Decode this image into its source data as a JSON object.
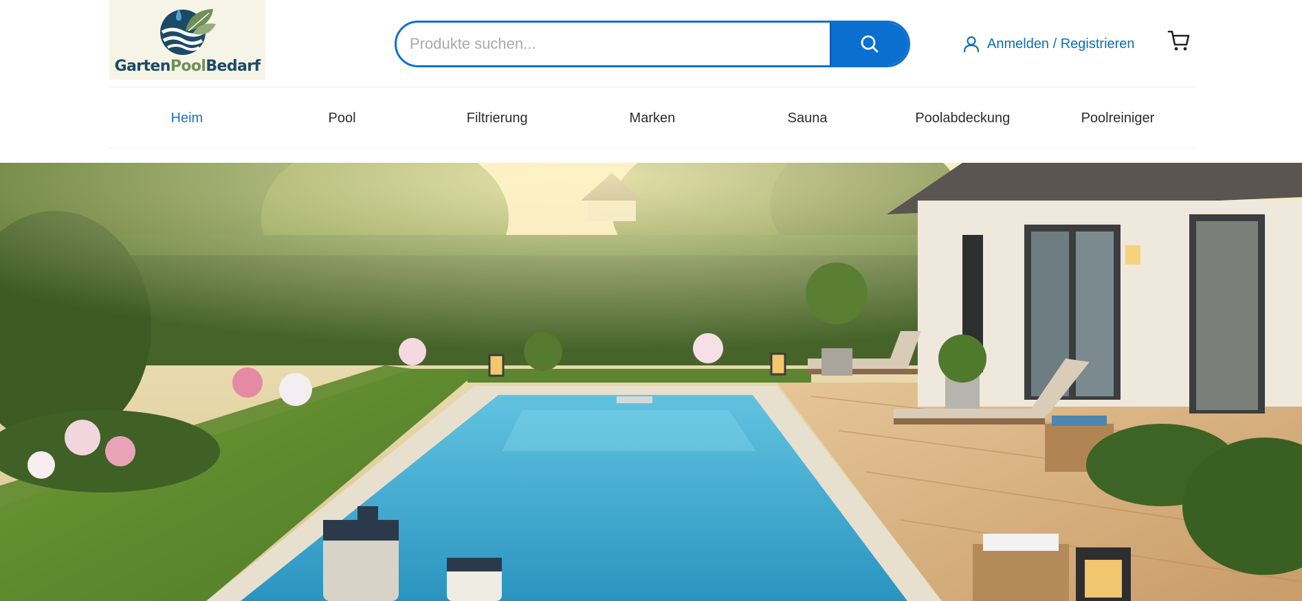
{
  "brand": {
    "logo_word_1": "Garten",
    "logo_word_2": "Pool",
    "logo_word_3": "Bedarf",
    "colors": {
      "primary": "#0b6fd0",
      "navy": "#1b4a66",
      "leaf": "#6f8f5a",
      "link": "#0b6fb5"
    }
  },
  "search": {
    "placeholder": "Produkte suchen...",
    "value": "",
    "button_icon": "search-icon"
  },
  "account": {
    "icon": "user-icon",
    "label": "Anmelden / Registrieren"
  },
  "cart": {
    "icon": "cart-icon"
  },
  "nav": {
    "items": [
      {
        "label": "Heim",
        "active": true
      },
      {
        "label": "Pool",
        "active": false
      },
      {
        "label": "Filtrierung",
        "active": false
      },
      {
        "label": "Marken",
        "active": false
      },
      {
        "label": "Sauna",
        "active": false
      },
      {
        "label": "Poolabdeckung",
        "active": false
      },
      {
        "label": "Poolreiniger",
        "active": false
      }
    ]
  },
  "hero": {
    "image": "garden-pool-hero",
    "colors": {
      "sky": "#f2e7c8",
      "hedge": "#4a6a2a",
      "water": "#3aa8cc",
      "deck": "#d9b486",
      "wall": "#efe8dc"
    }
  }
}
